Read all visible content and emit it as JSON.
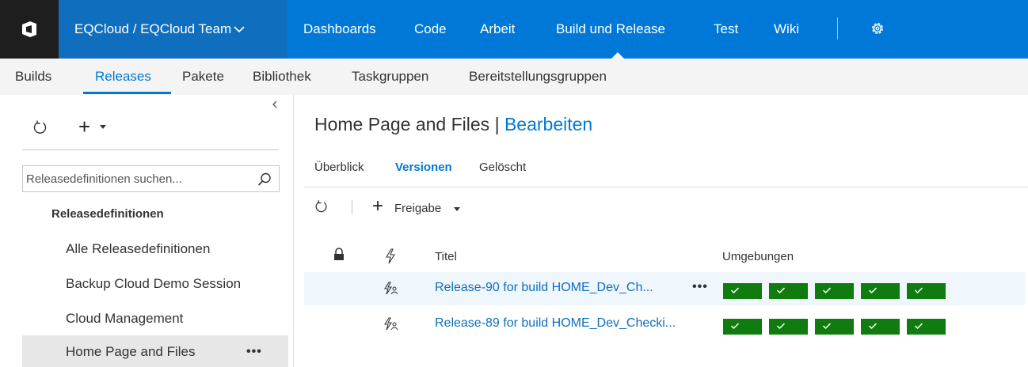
{
  "header": {
    "project": "EQCloud / EQCloud Team",
    "nav": [
      {
        "label": "Dashboards"
      },
      {
        "label": "Code"
      },
      {
        "label": "Arbeit"
      },
      {
        "label": "Build und Release"
      },
      {
        "label": "Test"
      },
      {
        "label": "Wiki"
      }
    ],
    "active_nav": "Build und Release"
  },
  "subnav": {
    "items": [
      "Builds",
      "Releases",
      "Pakete",
      "Bibliothek",
      "Taskgruppen",
      "Bereitstellungsgruppen"
    ],
    "active": "Releases"
  },
  "sidebar": {
    "search_placeholder": "Releasedefinitionen suchen...",
    "section_header": "Releasedefinitionen",
    "items": [
      {
        "label": "Alle Releasedefinitionen"
      },
      {
        "label": "Backup Cloud Demo Session"
      },
      {
        "label": "Cloud Management"
      },
      {
        "label": "Home Page and Files",
        "selected": true
      }
    ],
    "more_label": "•••"
  },
  "main": {
    "title": "Home Page and Files",
    "title_separator": "|",
    "edit_link": "Bearbeiten",
    "tabs": [
      "Überblick",
      "Versionen",
      "Gelöscht"
    ],
    "active_tab": "Versionen",
    "toolbar": {
      "release_label": "Freigabe"
    },
    "columns": {
      "title": "Titel",
      "environments": "Umgebungen"
    },
    "rows": [
      {
        "title": "Release-90 for build HOME_Dev_Ch...",
        "more": "•••",
        "environments": [
          "success",
          "success",
          "success",
          "success",
          "success"
        ]
      },
      {
        "title": "Release-89 for build HOME_Dev_Checki...",
        "environments": [
          "success",
          "success",
          "success",
          "success",
          "success"
        ]
      }
    ]
  },
  "colors": {
    "brand_blue": "#0078d7",
    "success_green": "#107c10",
    "row_highlight": "#eff6fc"
  },
  "icons": [
    "vsts-logo-icon",
    "chevron-down-icon",
    "gear-icon",
    "refresh-icon",
    "plus-icon",
    "search-icon",
    "lock-icon",
    "lightning-icon",
    "manual-trigger-icon",
    "checkmark-icon",
    "collapse-chevron-icon"
  ]
}
